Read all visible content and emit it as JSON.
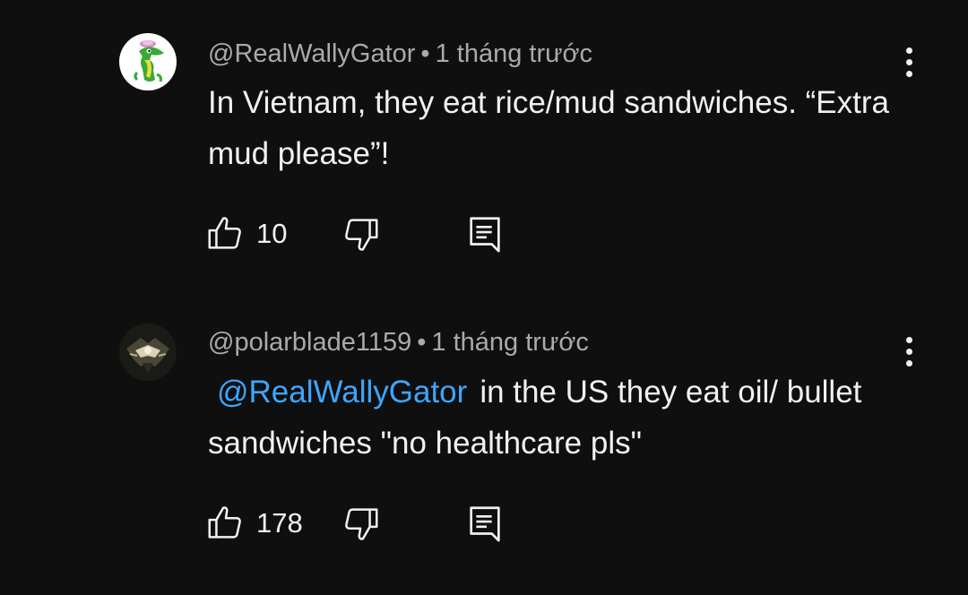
{
  "comments": [
    {
      "author": "@RealWallyGator",
      "separator": "•",
      "time": "1 tháng trước",
      "text": "In Vietnam, they eat rice/mud sandwiches. “Extra mud please”!",
      "mention": "",
      "likes": "10"
    },
    {
      "author": "@polarblade1159",
      "separator": "•",
      "time": "1 tháng trước",
      "mention": "@RealWallyGator",
      "text": "in the US they eat oil/ bullet sandwiches \"no healthcare pls\"",
      "likes": "178"
    }
  ],
  "icons": {
    "like": "thumbs-up-icon",
    "dislike": "thumbs-down-icon",
    "reply": "reply-comment-icon",
    "more": "more-vert-icon"
  },
  "colors": {
    "background": "#0f0f0f",
    "text": "#f1f1f1",
    "meta": "#aaaaaa",
    "mention": "#3ea6ff"
  }
}
